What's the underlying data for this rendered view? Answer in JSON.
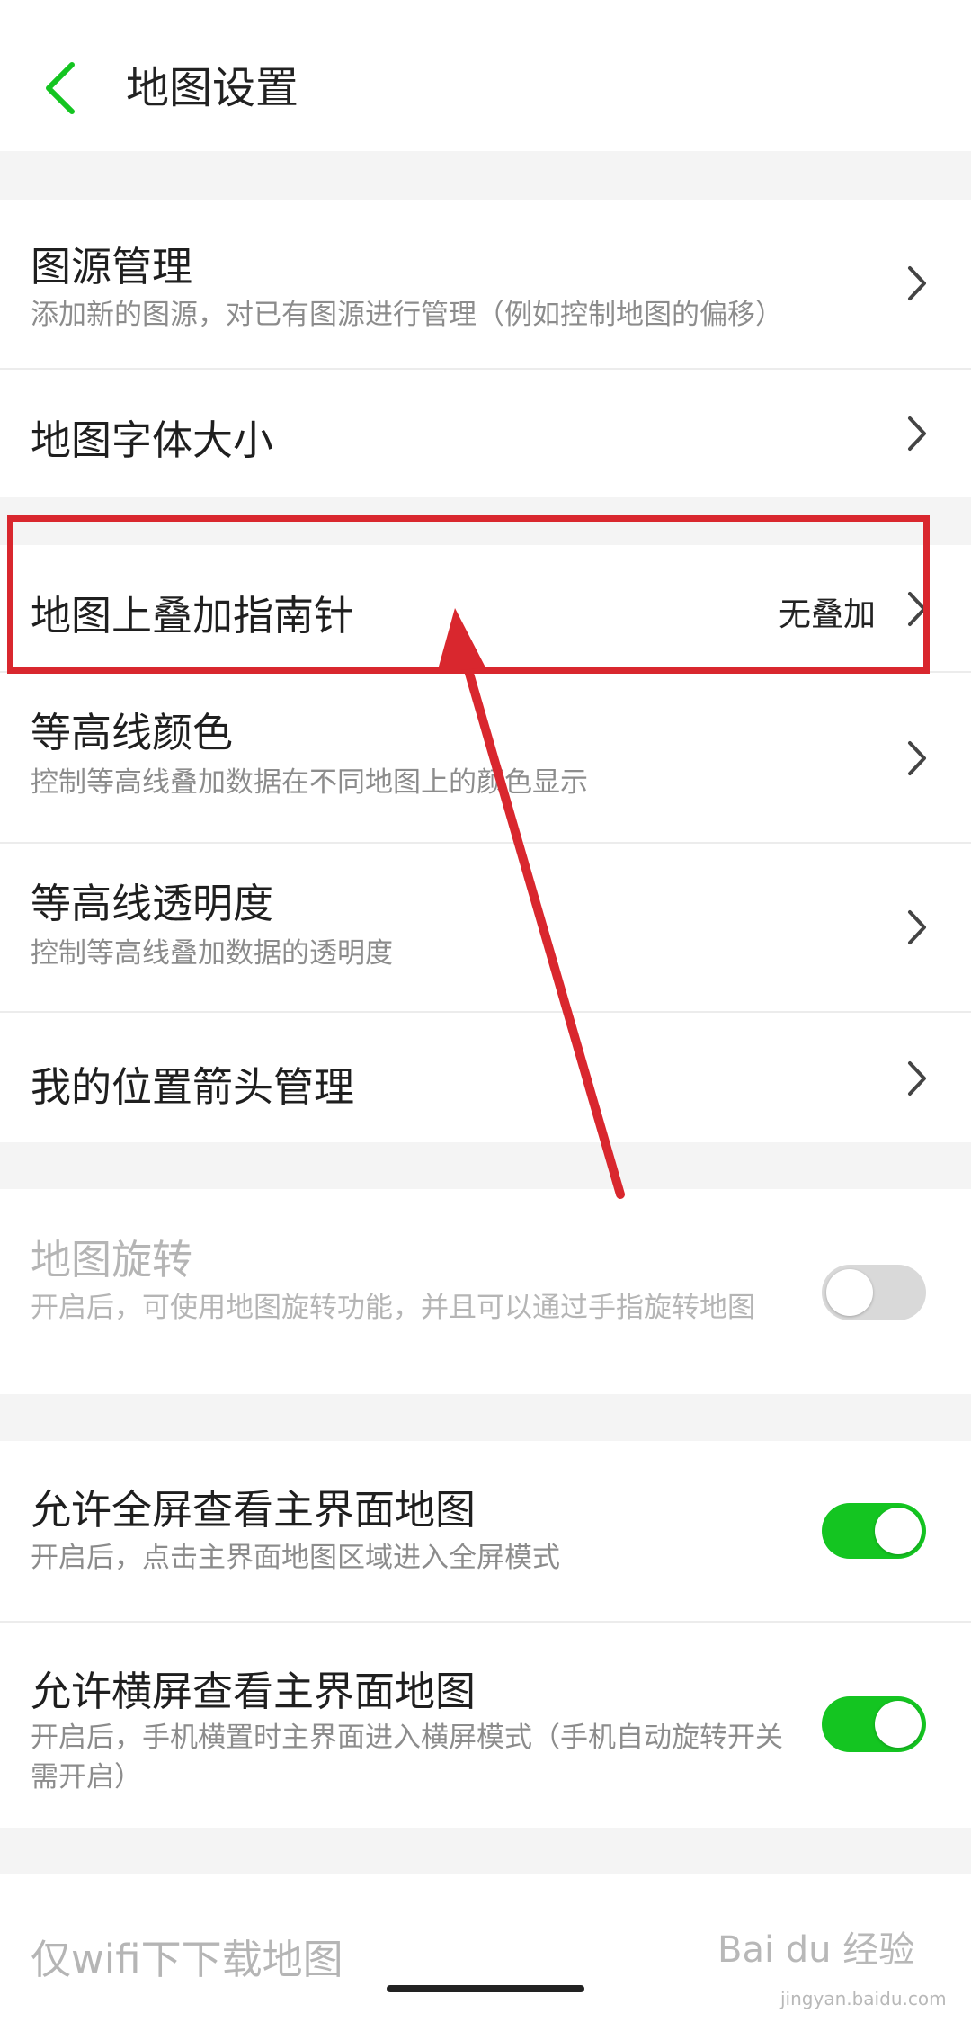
{
  "header": {
    "title": "地图设置",
    "back_icon": "chevron-left-icon"
  },
  "colors": {
    "accent": "#14c521",
    "annotation": "#d9272e"
  },
  "settings": {
    "map_source": {
      "label": "图源管理",
      "desc": "添加新的图源，对已有图源进行管理（例如控制地图的偏移）"
    },
    "font_size": {
      "label": "地图字体大小"
    },
    "compass_overlay": {
      "label": "地图上叠加指南针",
      "value": "无叠加"
    },
    "contour_color": {
      "label": "等高线颜色",
      "desc": "控制等高线叠加数据在不同地图上的颜色显示"
    },
    "contour_opacity": {
      "label": "等高线透明度",
      "desc": "控制等高线叠加数据的透明度"
    },
    "location_arrow": {
      "label": "我的位置箭头管理"
    },
    "map_rotation": {
      "label": "地图旋转",
      "desc": "开启后，可使用地图旋转功能，并且可以通过手指旋转地图",
      "enabled": false,
      "disabled": true
    },
    "fullscreen_map": {
      "label": "允许全屏查看主界面地图",
      "desc": "开启后，点击主界面地图区域进入全屏模式",
      "enabled": true
    },
    "landscape_map": {
      "label": "允许横屏查看主界面地图",
      "desc": "开启后，手机横置时主界面进入横屏模式（手机自动旋转开关需开启）",
      "enabled": true
    },
    "wifi_download": {
      "label": "仅wifi下下载地图"
    }
  },
  "watermark": {
    "text": "Bai du 经验",
    "sub": "jingyan.baidu.com"
  }
}
